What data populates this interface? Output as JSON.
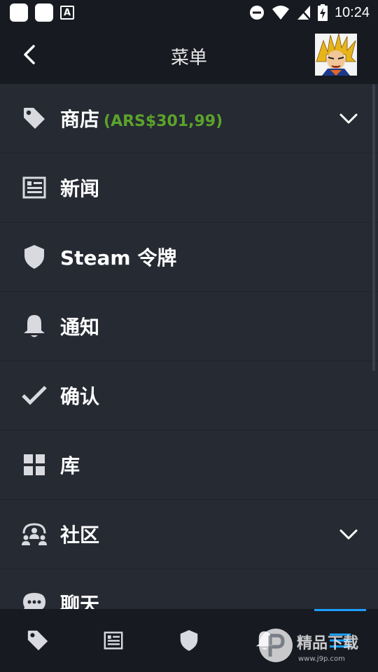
{
  "status_bar": {
    "time": "10:24",
    "notification_letter": "A"
  },
  "header": {
    "title": "菜单",
    "back_icon": "chevron-left-icon",
    "avatar": "user-avatar"
  },
  "menu": {
    "items": [
      {
        "label": "商店",
        "sub": "(ARS$301,99)",
        "icon": "tag-icon",
        "expandable": true
      },
      {
        "label": "新闻",
        "icon": "newspaper-icon"
      },
      {
        "label": "Steam 令牌",
        "icon": "shield-icon"
      },
      {
        "label": "通知",
        "icon": "bell-icon"
      },
      {
        "label": "确认",
        "icon": "checkmark-icon"
      },
      {
        "label": "库",
        "icon": "grid-icon"
      },
      {
        "label": "社区",
        "icon": "community-icon",
        "expandable": true
      },
      {
        "label": "聊天",
        "icon": "chat-icon"
      }
    ]
  },
  "bottom_nav": {
    "tabs": [
      {
        "icon": "tag-icon"
      },
      {
        "icon": "newspaper-icon"
      },
      {
        "icon": "shield-icon"
      },
      {
        "icon": "bell-icon"
      },
      {
        "icon": "menu-icon",
        "active": true
      }
    ]
  },
  "watermark": {
    "text": "精品下载",
    "url": "www.j9p.com"
  },
  "colors": {
    "background": "#171a21",
    "menu_background": "#262a33",
    "price_green": "#5ba32b",
    "active_blue": "#1a9fff"
  }
}
